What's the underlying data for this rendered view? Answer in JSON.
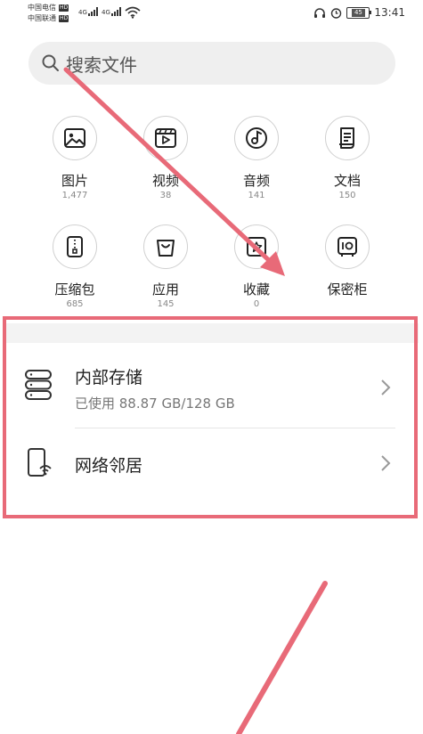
{
  "status_bar": {
    "carrier1": "中国电信",
    "carrier2": "中国联通",
    "hd": "HD",
    "net_type": "4G",
    "battery": "45",
    "time": "13:41"
  },
  "search": {
    "placeholder": "搜索文件"
  },
  "categories": [
    {
      "label": "图片",
      "count": "1,477",
      "icon": "image-icon"
    },
    {
      "label": "视频",
      "count": "38",
      "icon": "video-icon"
    },
    {
      "label": "音频",
      "count": "141",
      "icon": "audio-icon"
    },
    {
      "label": "文档",
      "count": "150",
      "icon": "document-icon"
    },
    {
      "label": "压缩包",
      "count": "685",
      "icon": "archive-icon"
    },
    {
      "label": "应用",
      "count": "145",
      "icon": "app-icon"
    },
    {
      "label": "收藏",
      "count": "0",
      "icon": "favorite-icon"
    },
    {
      "label": "保密柜",
      "count": "",
      "icon": "safe-icon"
    }
  ],
  "storage": {
    "internal_title": "内部存储",
    "internal_usage": "已使用 88.87 GB/128 GB",
    "network_title": "网络邻居"
  },
  "colors": {
    "annotation": "#e86a78",
    "search_bg": "#efefef"
  }
}
